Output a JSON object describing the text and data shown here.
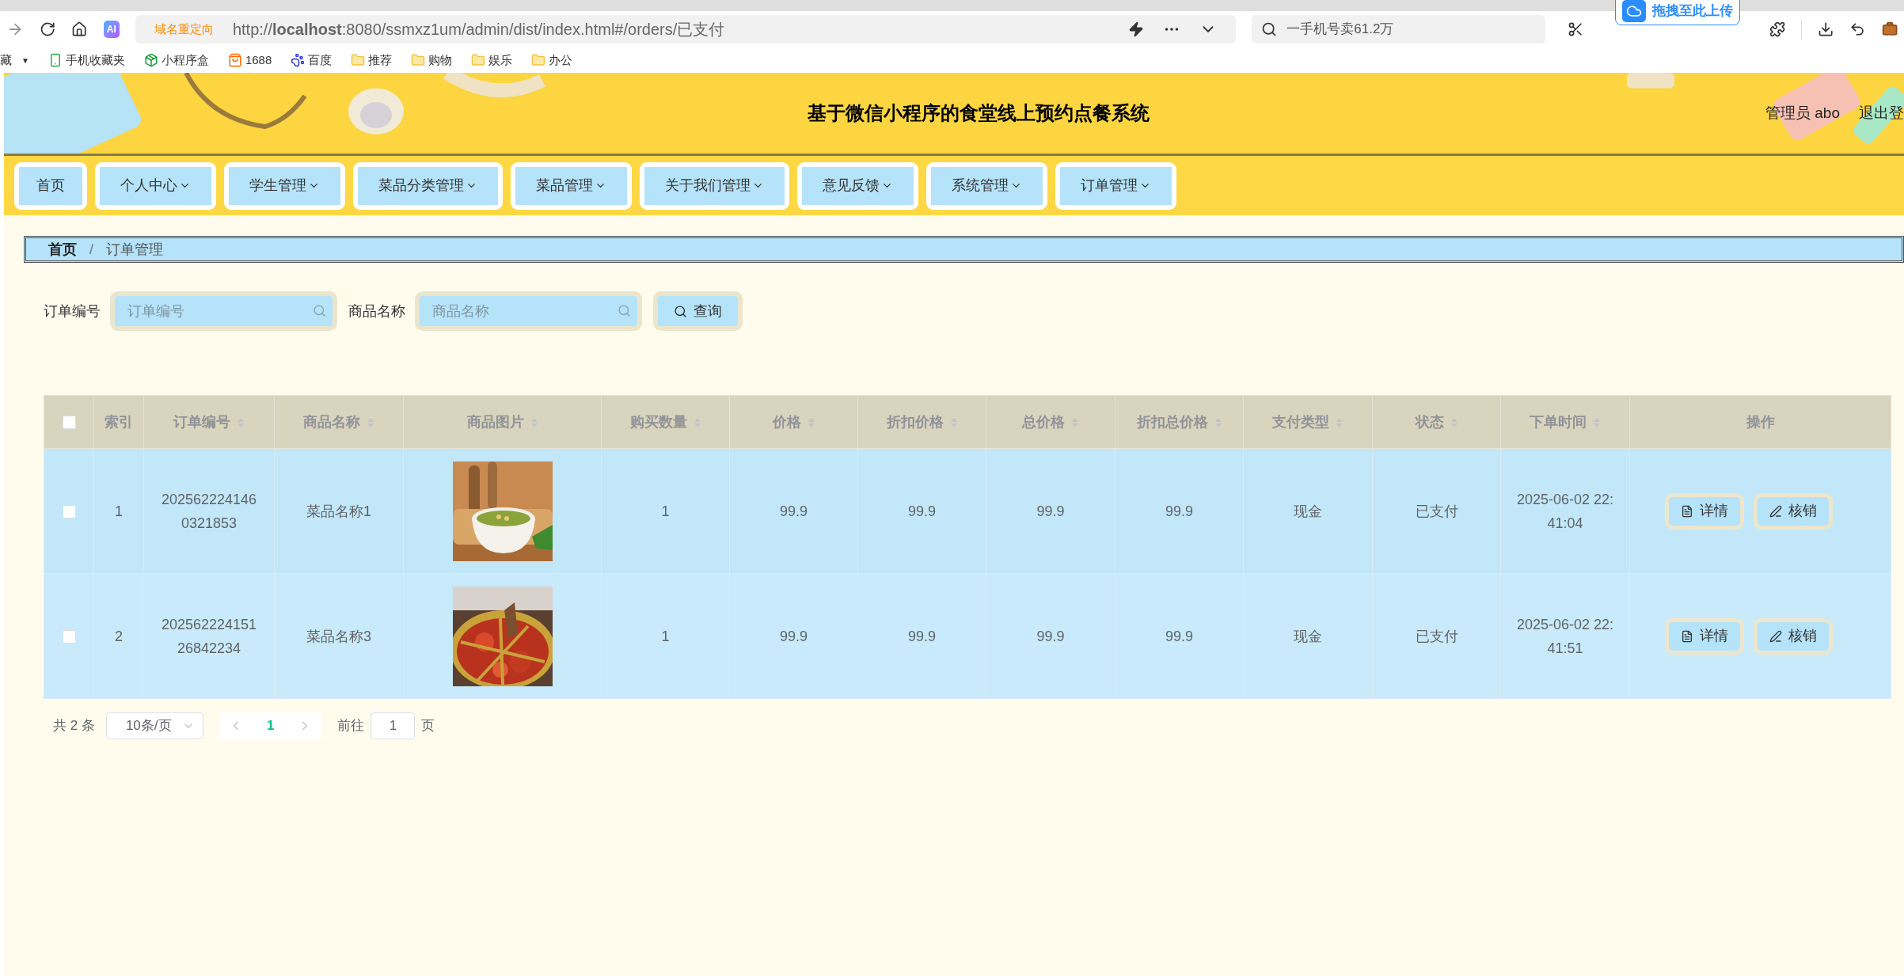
{
  "browser": {
    "ai_label": "AI",
    "address_badge": "域名重定向",
    "url": "http://**localhost**:8080/ssmxz1um/admin/dist/index.html#/orders/已支付",
    "search": "一手机号卖61.2万",
    "upload_badge": "拖拽至此上传",
    "bookmarks": [
      {
        "label": "藏",
        "kind": "menu",
        "arrow": "▼"
      },
      {
        "label": "手机收藏夹",
        "kind": "phone"
      },
      {
        "label": "小程序盒",
        "kind": "box"
      },
      {
        "label": "1688",
        "kind": "shop"
      },
      {
        "label": "百度",
        "kind": "paw"
      },
      {
        "label": "推荐",
        "kind": "folder"
      },
      {
        "label": "购物",
        "kind": "folder"
      },
      {
        "label": "娱乐",
        "kind": "folder"
      },
      {
        "label": "办公",
        "kind": "folder"
      }
    ]
  },
  "header": {
    "title": "基于微信小程序的食堂线上预约点餐系统",
    "user": "管理员 abo",
    "logout": "退出登"
  },
  "nav": [
    {
      "label": "首页",
      "dropdown": false
    },
    {
      "label": "个人中心",
      "dropdown": true
    },
    {
      "label": "学生管理",
      "dropdown": true
    },
    {
      "label": "菜品分类管理",
      "dropdown": true
    },
    {
      "label": "菜品管理",
      "dropdown": true
    },
    {
      "label": "关于我们管理",
      "dropdown": true
    },
    {
      "label": "意见反馈",
      "dropdown": true
    },
    {
      "label": "系统管理",
      "dropdown": true
    },
    {
      "label": "订单管理",
      "dropdown": true
    }
  ],
  "breadcrumb": {
    "separator": "/",
    "items": [
      "首页",
      "订单管理"
    ]
  },
  "search": {
    "fields": [
      {
        "label": "订单编号",
        "placeholder": "订单编号"
      },
      {
        "label": "商品名称",
        "placeholder": "商品名称"
      }
    ],
    "button": "查询"
  },
  "table": {
    "all_checked": false,
    "columns": [
      {
        "label": "索引",
        "sortable": false
      },
      {
        "label": "订单编号",
        "sortable": true
      },
      {
        "label": "商品名称",
        "sortable": true
      },
      {
        "label": "商品图片",
        "sortable": true
      },
      {
        "label": "购买数量",
        "sortable": true
      },
      {
        "label": "价格",
        "sortable": true
      },
      {
        "label": "折扣价格",
        "sortable": true
      },
      {
        "label": "总价格",
        "sortable": true
      },
      {
        "label": "折扣总价格",
        "sortable": true
      },
      {
        "label": "支付类型",
        "sortable": true
      },
      {
        "label": "状态",
        "sortable": true
      },
      {
        "label": "下单时间",
        "sortable": true
      },
      {
        "label": "操作",
        "sortable": false
      }
    ],
    "rows": [
      {
        "checked": false,
        "cells": [
          "1",
          "2025622241460321853",
          "菜品名称1",
          {
            "kind": "picture"
          },
          "1",
          "99.9",
          "99.9",
          "99.9",
          "99.9",
          "现金",
          "已支付",
          "2025-06-02 22:41:04"
        ],
        "actions": [
          "详情",
          "核销"
        ]
      },
      {
        "checked": false,
        "cells": [
          "2",
          "20256222415126842234",
          "菜品名称3",
          {
            "kind": "picture"
          },
          "1",
          "99.9",
          "99.9",
          "99.9",
          "99.9",
          "现金",
          "已支付",
          "2025-06-02 22:41:51"
        ],
        "actions": [
          "详情",
          "核销"
        ]
      }
    ]
  },
  "pagination": {
    "total": "共 2 条",
    "page_size": "10条/页",
    "pages": [
      {
        "label": "1",
        "selected": true
      }
    ],
    "goto": "前往",
    "goto_value": "1",
    "unit": "页"
  }
}
